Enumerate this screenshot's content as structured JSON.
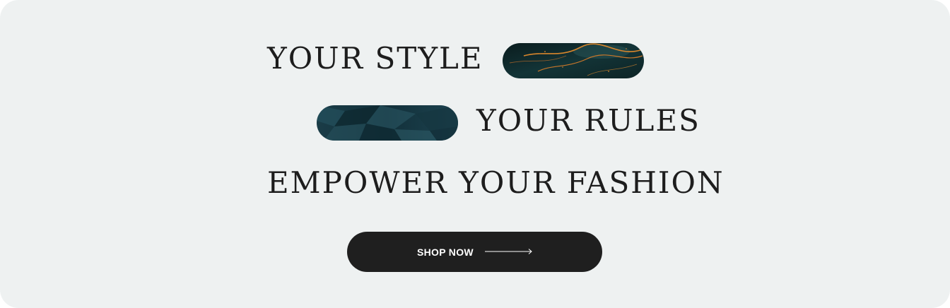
{
  "hero": {
    "line1": "YOUR STYLE",
    "line2": "YOUR RULES",
    "line3": "EMPOWER YOUR FASHION",
    "image_1": "dark-teal-texture-with-orange-streaks",
    "image_2": "crumpled-teal-paper-texture"
  },
  "cta": {
    "label": "SHOP NOW",
    "icon": "long-arrow-right-icon"
  },
  "colors": {
    "background": "#eef1f1",
    "text": "#1d1d1d",
    "button": "#1f1f1f",
    "button_text": "#ffffff",
    "texture_dark": "#0f2a2c",
    "texture_accent": "#d8862c"
  }
}
